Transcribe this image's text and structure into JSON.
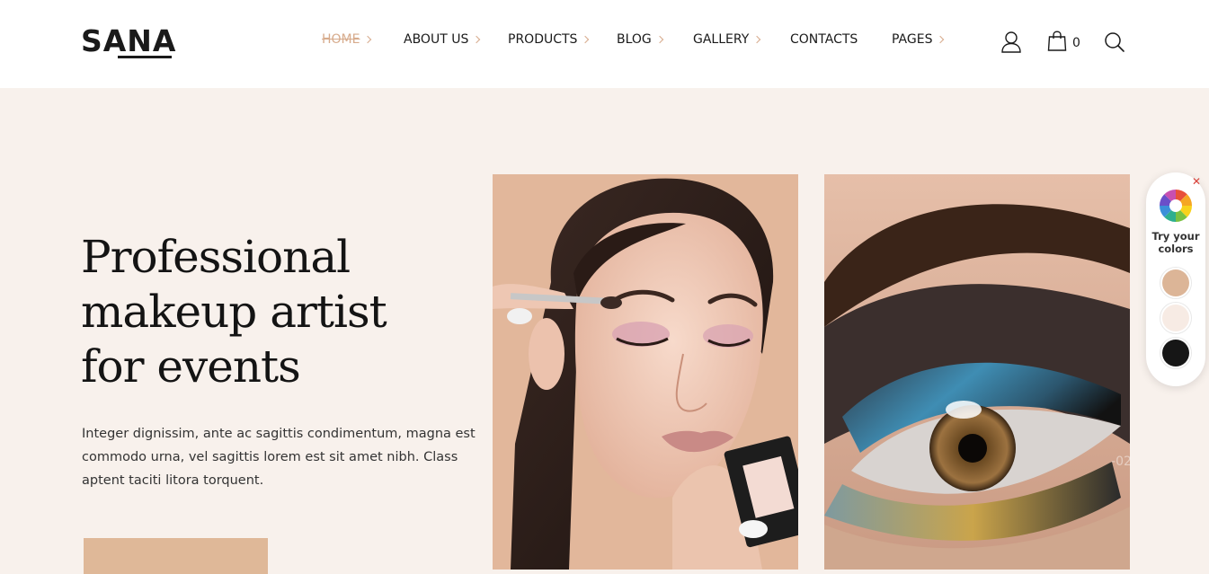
{
  "brand": {
    "logo_text": "SANA"
  },
  "nav": {
    "items": [
      {
        "label": "HOME",
        "has_submenu": true,
        "active": true
      },
      {
        "label": "ABOUT US",
        "has_submenu": true
      },
      {
        "label": "PRODUCTS",
        "has_submenu": true
      },
      {
        "label": "BLOG",
        "has_submenu": true
      },
      {
        "label": "GALLERY",
        "has_submenu": true
      },
      {
        "label": "CONTACTS",
        "has_submenu": false
      },
      {
        "label": "PAGES",
        "has_submenu": true
      }
    ]
  },
  "header_icons": {
    "account": "user-icon",
    "cart": "shopping-bag-icon",
    "search": "search-icon",
    "cart_count": "0"
  },
  "hero": {
    "title_line1": "Professional",
    "title_line2": "makeup artist",
    "title_line3": "for events",
    "description": "Integer dignissim, ante ac sagittis condimentum, magna est commodo urna, vel sagittis lorem est sit amet nibh. Class aptent taciti litora torquent."
  },
  "slider": {
    "slide_number": "02"
  },
  "color_panel": {
    "label": "Try your colors",
    "swatches": [
      "#dcb597",
      "#f7ebe4",
      "#161616"
    ]
  },
  "colors": {
    "accent": "#d7ab8c",
    "background": "#f8f1ec",
    "button": "#dfb898",
    "text": "#141414"
  }
}
